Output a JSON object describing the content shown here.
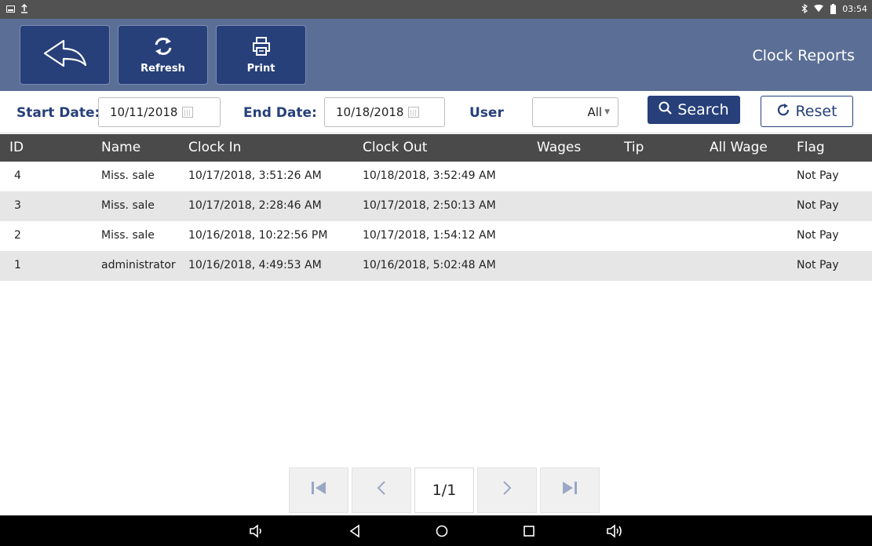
{
  "status_bar": {
    "time": "03:54",
    "left_icons": [
      "screenshot-icon",
      "upload-icon"
    ],
    "right_icons": [
      "bluetooth-icon",
      "wifi-icon",
      "battery-icon"
    ]
  },
  "header": {
    "back_icon": "back-arrow-icon",
    "refresh_label": "Refresh",
    "refresh_icon": "refresh-icon",
    "print_label": "Print",
    "print_icon": "printer-icon",
    "title": "Clock Reports"
  },
  "filters": {
    "start_label": "Start Date:",
    "start_value": "10/11/2018",
    "end_label": "End Date:",
    "end_value": "10/18/2018",
    "user_label": "User",
    "user_value": "All",
    "search_label": "Search",
    "reset_label": "Reset"
  },
  "table": {
    "columns": [
      "ID",
      "Name",
      "Clock In",
      "Clock Out",
      "Wages",
      "Tip",
      "All Wage",
      "Flag"
    ],
    "rows": [
      {
        "id": "4",
        "name": "Miss. sale",
        "clock_in": "10/17/2018, 3:51:26 AM",
        "clock_out": "10/18/2018, 3:52:49 AM",
        "wages": "",
        "tip": "",
        "all_wage": "",
        "flag": "Not Pay"
      },
      {
        "id": "3",
        "name": "Miss. sale",
        "clock_in": "10/17/2018, 2:28:46 AM",
        "clock_out": "10/17/2018, 2:50:13 AM",
        "wages": "",
        "tip": "",
        "all_wage": "",
        "flag": "Not Pay"
      },
      {
        "id": "2",
        "name": "Miss. sale",
        "clock_in": "10/16/2018, 10:22:56 PM",
        "clock_out": "10/17/2018, 1:54:12 AM",
        "wages": "",
        "tip": "",
        "all_wage": "",
        "flag": "Not Pay"
      },
      {
        "id": "1",
        "name": "administrator",
        "clock_in": "10/16/2018, 4:49:53 AM",
        "clock_out": "10/16/2018, 5:02:48 AM",
        "wages": "",
        "tip": "",
        "all_wage": "",
        "flag": "Not Pay"
      }
    ]
  },
  "pager": {
    "page": "1/1"
  },
  "colors": {
    "header_bg": "#5b6e95",
    "button_bg": "#27407a",
    "table_header_bg": "#4a4a4a",
    "row_alt_bg": "#e6e6e6"
  }
}
